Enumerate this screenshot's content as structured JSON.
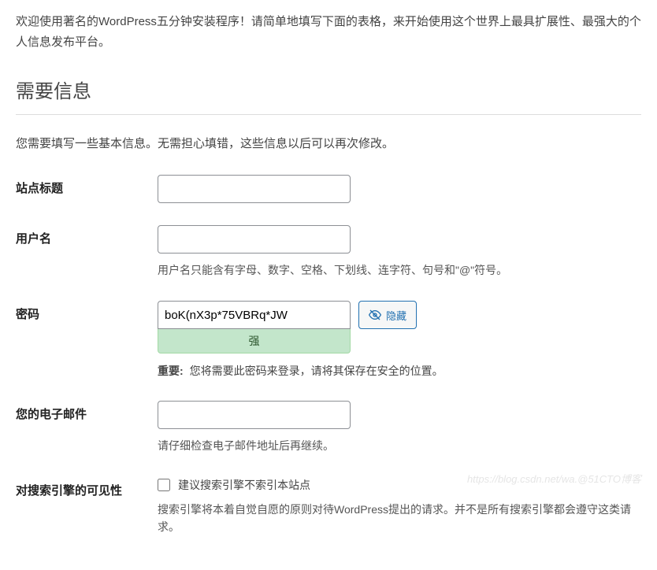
{
  "welcome": "欢迎使用著名的WordPress五分钟安装程序！请简单地填写下面的表格，来开始使用这个世界上最具扩展性、最强大的个人信息发布平台。",
  "heading": "需要信息",
  "info": "您需要填写一些基本信息。无需担心填错，这些信息以后可以再次修改。",
  "fields": {
    "site_title": {
      "label": "站点标题",
      "value": ""
    },
    "username": {
      "label": "用户名",
      "value": "",
      "hint": "用户名只能含有字母、数字、空格、下划线、连字符、句号和\"@\"符号。"
    },
    "password": {
      "label": "密码",
      "value": "boK(nX3p*75VBRq*JW",
      "hide_button": "隐藏",
      "strength": "强",
      "important_label": "重要:",
      "important_text": "您将需要此密码来登录，请将其保存在安全的位置。"
    },
    "email": {
      "label": "您的电子邮件",
      "value": "",
      "hint": "请仔细检查电子邮件地址后再继续。"
    },
    "search_engine": {
      "label": "对搜索引擎的可见性",
      "checkbox_label": "建议搜索引擎不索引本站点",
      "hint": "搜索引擎将本着自觉自愿的原则对待WordPress提出的请求。并不是所有搜索引擎都会遵守这类请求。"
    }
  },
  "watermark": "https://blog.csdn.net/wa.@51CTO博客"
}
